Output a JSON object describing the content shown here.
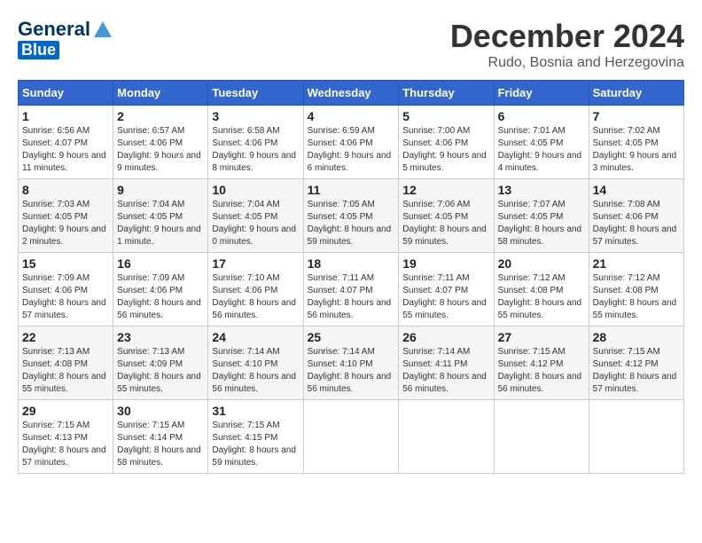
{
  "logo": {
    "general": "General",
    "blue": "Blue"
  },
  "title": "December 2024",
  "location": "Rudo, Bosnia and Herzegovina",
  "days_of_week": [
    "Sunday",
    "Monday",
    "Tuesday",
    "Wednesday",
    "Thursday",
    "Friday",
    "Saturday"
  ],
  "weeks": [
    [
      {
        "day": "1",
        "sunrise": "6:56 AM",
        "sunset": "4:07 PM",
        "daylight": "9 hours and 11 minutes."
      },
      {
        "day": "2",
        "sunrise": "6:57 AM",
        "sunset": "4:06 PM",
        "daylight": "9 hours and 9 minutes."
      },
      {
        "day": "3",
        "sunrise": "6:58 AM",
        "sunset": "4:06 PM",
        "daylight": "9 hours and 8 minutes."
      },
      {
        "day": "4",
        "sunrise": "6:59 AM",
        "sunset": "4:06 PM",
        "daylight": "9 hours and 6 minutes."
      },
      {
        "day": "5",
        "sunrise": "7:00 AM",
        "sunset": "4:06 PM",
        "daylight": "9 hours and 5 minutes."
      },
      {
        "day": "6",
        "sunrise": "7:01 AM",
        "sunset": "4:05 PM",
        "daylight": "9 hours and 4 minutes."
      },
      {
        "day": "7",
        "sunrise": "7:02 AM",
        "sunset": "4:05 PM",
        "daylight": "9 hours and 3 minutes."
      }
    ],
    [
      {
        "day": "8",
        "sunrise": "7:03 AM",
        "sunset": "4:05 PM",
        "daylight": "9 hours and 2 minutes."
      },
      {
        "day": "9",
        "sunrise": "7:04 AM",
        "sunset": "4:05 PM",
        "daylight": "9 hours and 1 minute."
      },
      {
        "day": "10",
        "sunrise": "7:04 AM",
        "sunset": "4:05 PM",
        "daylight": "9 hours and 0 minutes."
      },
      {
        "day": "11",
        "sunrise": "7:05 AM",
        "sunset": "4:05 PM",
        "daylight": "8 hours and 59 minutes."
      },
      {
        "day": "12",
        "sunrise": "7:06 AM",
        "sunset": "4:05 PM",
        "daylight": "8 hours and 59 minutes."
      },
      {
        "day": "13",
        "sunrise": "7:07 AM",
        "sunset": "4:05 PM",
        "daylight": "8 hours and 58 minutes."
      },
      {
        "day": "14",
        "sunrise": "7:08 AM",
        "sunset": "4:06 PM",
        "daylight": "8 hours and 57 minutes."
      }
    ],
    [
      {
        "day": "15",
        "sunrise": "7:09 AM",
        "sunset": "4:06 PM",
        "daylight": "8 hours and 57 minutes."
      },
      {
        "day": "16",
        "sunrise": "7:09 AM",
        "sunset": "4:06 PM",
        "daylight": "8 hours and 56 minutes."
      },
      {
        "day": "17",
        "sunrise": "7:10 AM",
        "sunset": "4:06 PM",
        "daylight": "8 hours and 56 minutes."
      },
      {
        "day": "18",
        "sunrise": "7:11 AM",
        "sunset": "4:07 PM",
        "daylight": "8 hours and 56 minutes."
      },
      {
        "day": "19",
        "sunrise": "7:11 AM",
        "sunset": "4:07 PM",
        "daylight": "8 hours and 55 minutes."
      },
      {
        "day": "20",
        "sunrise": "7:12 AM",
        "sunset": "4:08 PM",
        "daylight": "8 hours and 55 minutes."
      },
      {
        "day": "21",
        "sunrise": "7:12 AM",
        "sunset": "4:08 PM",
        "daylight": "8 hours and 55 minutes."
      }
    ],
    [
      {
        "day": "22",
        "sunrise": "7:13 AM",
        "sunset": "4:08 PM",
        "daylight": "8 hours and 55 minutes."
      },
      {
        "day": "23",
        "sunrise": "7:13 AM",
        "sunset": "4:09 PM",
        "daylight": "8 hours and 55 minutes."
      },
      {
        "day": "24",
        "sunrise": "7:14 AM",
        "sunset": "4:10 PM",
        "daylight": "8 hours and 56 minutes."
      },
      {
        "day": "25",
        "sunrise": "7:14 AM",
        "sunset": "4:10 PM",
        "daylight": "8 hours and 56 minutes."
      },
      {
        "day": "26",
        "sunrise": "7:14 AM",
        "sunset": "4:11 PM",
        "daylight": "8 hours and 56 minutes."
      },
      {
        "day": "27",
        "sunrise": "7:15 AM",
        "sunset": "4:12 PM",
        "daylight": "8 hours and 56 minutes."
      },
      {
        "day": "28",
        "sunrise": "7:15 AM",
        "sunset": "4:12 PM",
        "daylight": "8 hours and 57 minutes."
      }
    ],
    [
      {
        "day": "29",
        "sunrise": "7:15 AM",
        "sunset": "4:13 PM",
        "daylight": "8 hours and 57 minutes."
      },
      {
        "day": "30",
        "sunrise": "7:15 AM",
        "sunset": "4:14 PM",
        "daylight": "8 hours and 58 minutes."
      },
      {
        "day": "31",
        "sunrise": "7:15 AM",
        "sunset": "4:15 PM",
        "daylight": "8 hours and 59 minutes."
      },
      null,
      null,
      null,
      null
    ]
  ]
}
